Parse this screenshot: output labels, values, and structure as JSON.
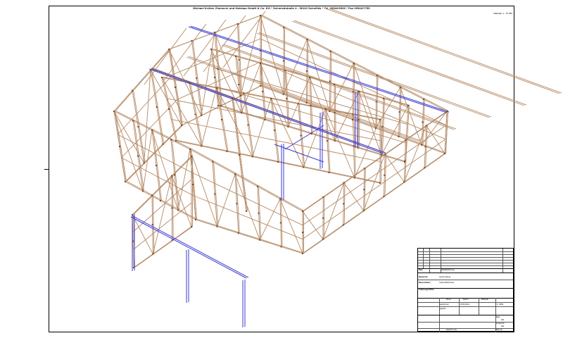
{
  "header": {
    "company_line": "Michael Kröber Zimmerei und Holzbau GmbH & Co. KG * Schmiedstraße 4 - 96110 Scheßlitz * Tel. 09542/9393 * Fax 09542/7759"
  },
  "scale_top": "Maßstab: 1 : 57,059",
  "title_block": {
    "rev_rows": [
      "-",
      "-",
      "-",
      "-",
      "-",
      "-"
    ],
    "doc_label": "Detailzeichnung",
    "builder_label": "Bauherr/in",
    "builder_value": "Günter Wenig",
    "project_label": "Bauvorhaben",
    "project_value": "Carport/Nebenbau",
    "header_label": "Plan",
    "date_label": "Datum",
    "name_label": "Name",
    "scale_label": "Maßstab",
    "scale_value": "1 : 57,9",
    "date_value": "25.05.2014",
    "drawn": "gezeichnet",
    "checked": "geprüft",
    "rev_label": "Änderungen/Plan",
    "sheet_label": "Blatt",
    "sheet_value": "001",
    "project_nr_label": "Projekt-Nr.",
    "plan_nr_label": "Plan-Nr.",
    "plan_nr_value": "001",
    "footer": "Dietrich's AG"
  },
  "colors": {
    "timber": "#b48a66",
    "steel": "#3a3ad0",
    "line": "#000000"
  }
}
